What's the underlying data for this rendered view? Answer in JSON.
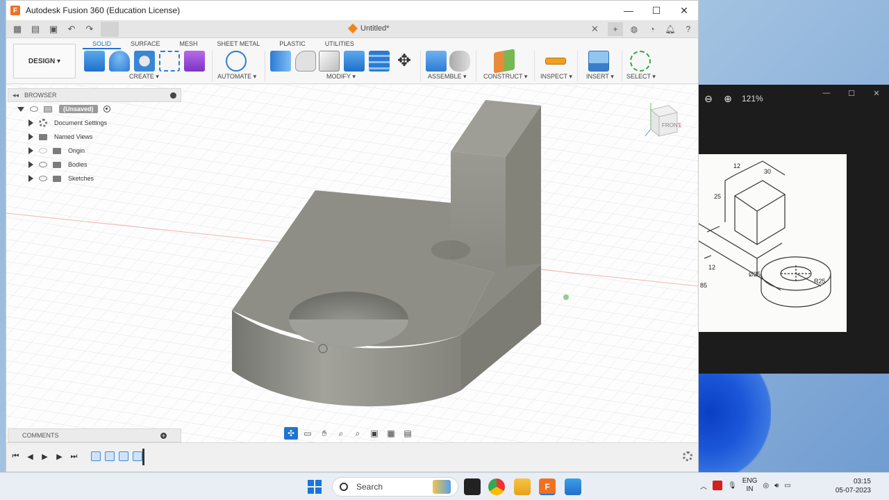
{
  "window": {
    "title": "Autodesk Fusion 360 (Education License)",
    "doc_title": "Untitled*"
  },
  "ribbon": {
    "workspace": "DESIGN",
    "tabs": [
      "SOLID",
      "SURFACE",
      "MESH",
      "SHEET METAL",
      "PLASTIC",
      "UTILITIES"
    ],
    "active_tab": "SOLID",
    "groups": [
      "CREATE",
      "AUTOMATE",
      "MODIFY",
      "ASSEMBLE",
      "CONSTRUCT",
      "INSPECT",
      "INSERT",
      "SELECT"
    ]
  },
  "browser": {
    "header": "BROWSER",
    "root": "(Unsaved)",
    "items": [
      "Document Settings",
      "Named Views",
      "Origin",
      "Bodies",
      "Sketches"
    ]
  },
  "viewcube": {
    "face": "FRONT"
  },
  "comments": {
    "label": "COMMENTS"
  },
  "viewer": {
    "zoom": "121%"
  },
  "drawing": {
    "labels": [
      "12",
      "30",
      "25",
      "12",
      "Ø25",
      "R25",
      "85"
    ]
  },
  "taskbar": {
    "search_placeholder": "Search",
    "lang_top": "ENG",
    "lang_bottom": "IN",
    "time": "03:15",
    "date": "05-07-2023"
  },
  "colors": {
    "accent": "#1f74d1",
    "fusion_orange": "#f07022",
    "model_gray": "#8e8e87"
  }
}
